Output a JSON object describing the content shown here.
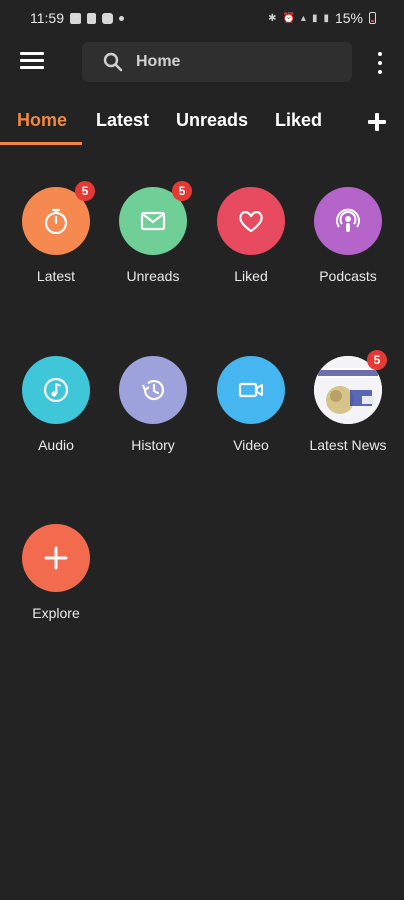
{
  "status_bar": {
    "time": "11:59",
    "battery": "15%"
  },
  "app_bar": {
    "search_text": "Home"
  },
  "tabs": [
    {
      "label": "Home",
      "active": true
    },
    {
      "label": "Latest",
      "active": false
    },
    {
      "label": "Unreads",
      "active": false
    },
    {
      "label": "Liked",
      "active": false
    }
  ],
  "tiles": [
    {
      "label": "Latest",
      "color": "#f6894f",
      "icon": "stopwatch-icon",
      "badge": "5"
    },
    {
      "label": "Unreads",
      "color": "#6fcf97",
      "icon": "mail-icon",
      "badge": "5"
    },
    {
      "label": "Liked",
      "color": "#e84a5f",
      "icon": "heart-icon",
      "badge": ""
    },
    {
      "label": "Podcasts",
      "color": "#b565c9",
      "icon": "podcast-icon",
      "badge": ""
    },
    {
      "label": "Audio",
      "color": "#3fc6d9",
      "icon": "music-note-icon",
      "badge": ""
    },
    {
      "label": "History",
      "color": "#9ea2dc",
      "icon": "history-icon",
      "badge": ""
    },
    {
      "label": "Video",
      "color": "#46b6f0",
      "icon": "video-camera-icon",
      "badge": ""
    },
    {
      "label": "Latest News",
      "color": "#ffffff",
      "icon": "news-thumbnail",
      "badge": "5"
    },
    {
      "label": "Explore",
      "color": "#f26b4e",
      "icon": "plus-icon",
      "badge": ""
    }
  ],
  "colors": {
    "background": "#232323",
    "accent": "#f2883f",
    "badge": "#e53935",
    "search_bg": "#2f2f2f"
  }
}
